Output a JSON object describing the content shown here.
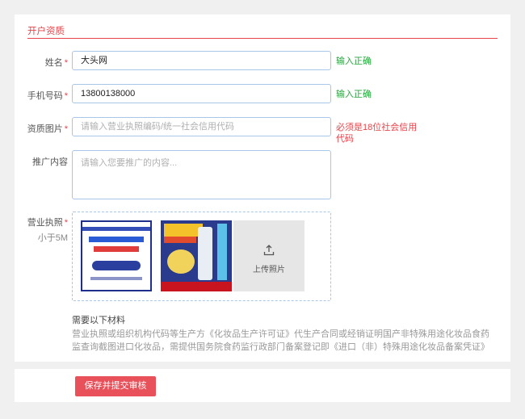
{
  "section": {
    "title": "开户资质"
  },
  "fields": {
    "name": {
      "label": "姓名",
      "required_mark": "*",
      "value": "大头网",
      "message": "输入正确"
    },
    "phone": {
      "label": "手机号码",
      "required_mark": "*",
      "value": "13800138000",
      "message": "输入正确"
    },
    "qualification_image": {
      "label": "资质图片",
      "required_mark": "*",
      "placeholder": "请输入营业执照编码/统一社会信用代码",
      "error": "必须是18位社会信用代码"
    },
    "promo": {
      "label": "推广内容",
      "placeholder": "请输入您要推广的内容..."
    },
    "license": {
      "label": "营业执照",
      "required_mark": "*",
      "sub_label": "小于5M",
      "upload_caption": "上传照片"
    }
  },
  "materials": {
    "heading": "需要以下材料",
    "description": "营业执照或组织机构代码等生产方《化妆品生产许可证》代生产合同或经销证明国产非特殊用途化妆品食药监查询截图进口化妆品，需提供国务院食药监行政部门备案登记即《进口（非）特殊用途化妆品备案凭证》"
  },
  "actions": {
    "submit_label": "保存并提交审核"
  },
  "colors": {
    "accent": "#e8434a",
    "success": "#21a83a",
    "input_border": "#a8c6e8",
    "button": "#e8505a"
  },
  "icons": {
    "upload": "upload-arrow-icon"
  }
}
